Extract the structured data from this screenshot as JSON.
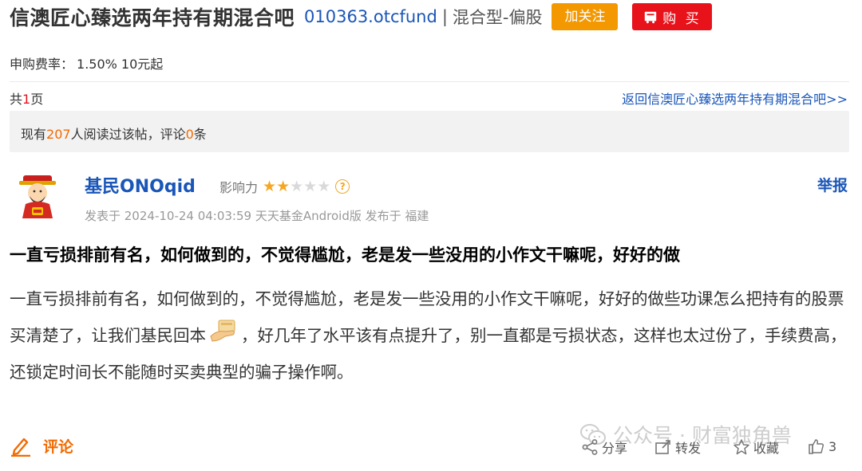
{
  "header": {
    "forum_title": "信澳匠心臻选两年持有期混合吧",
    "fund_code": "010363.otcfund",
    "separator": "|",
    "fund_type": "混合型-偏股",
    "follow_label": "加关注",
    "buy_label": "购 买"
  },
  "fee": {
    "label": "申购费率：",
    "value": "1.50% 10元起"
  },
  "pagination": {
    "prefix": "共",
    "count": "1",
    "suffix": "页",
    "back_link": "返回信澳匠心臻选两年持有期混合吧>>"
  },
  "stats": {
    "prefix": "现有",
    "readers": "207",
    "mid": "人阅读过该帖，评论",
    "comments": "0",
    "suffix": "条"
  },
  "post": {
    "author": "基民ONOqid",
    "influence_label": "影响力",
    "rating": 2,
    "rating_max": 5,
    "report_label": "举报",
    "meta": "发表于 2024-10-24 04:03:59 天天基金Android版 发布于 福建",
    "title": "一直亏损排前有名，如何做到的，不觉得尴尬，老是发一些没用的小作文干嘛呢，好好的做",
    "body_part1": "一直亏损排前有名，如何做到的，不觉得尴尬，老是发一些没用的小作文干嘛呢，好好的做些功课怎么把持有的股票买清楚了，让我们基民回本",
    "body_part2": "，好几年了水平该有点提升了，别一直都是亏损状态，这样也太过份了，手续费高，还锁定时间长不能随时买卖典型的骗子操作啊。"
  },
  "footer": {
    "comment_label": "评论",
    "share_label": "分享",
    "forward_label": "转发",
    "collect_label": "收藏",
    "like_count": "3",
    "watermark": "公众号 · 财富独角兽"
  },
  "colors": {
    "link_blue": "#1a56b8",
    "follow_orange": "#f39800",
    "buy_red": "#e8121b",
    "star_gold": "#f5a623"
  }
}
